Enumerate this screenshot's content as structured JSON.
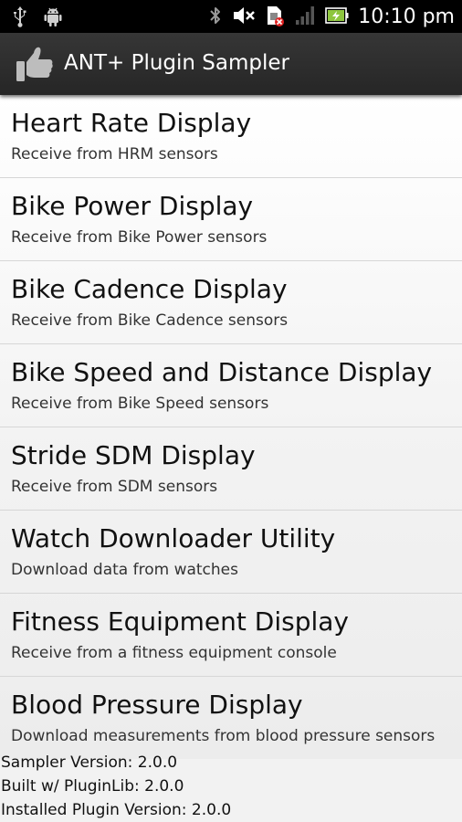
{
  "status_bar": {
    "time": "10:10 pm",
    "icons": [
      "usb-icon",
      "android-debug-icon",
      "bluetooth-icon",
      "mute-icon",
      "sim-missing-icon",
      "signal-icon",
      "battery-charging-icon"
    ]
  },
  "action_bar": {
    "title": "ANT+ Plugin Sampler",
    "icon": "thumbs-up-icon"
  },
  "list": {
    "items": [
      {
        "title": "Heart Rate Display",
        "subtitle": "Receive from HRM sensors"
      },
      {
        "title": "Bike Power Display",
        "subtitle": "Receive from Bike Power sensors"
      },
      {
        "title": "Bike Cadence Display",
        "subtitle": "Receive from Bike Cadence sensors"
      },
      {
        "title": "Bike Speed and Distance Display",
        "subtitle": "Receive from Bike Speed sensors"
      },
      {
        "title": "Stride SDM Display",
        "subtitle": "Receive from SDM sensors"
      },
      {
        "title": "Watch Downloader Utility",
        "subtitle": "Download data from watches"
      },
      {
        "title": "Fitness Equipment Display",
        "subtitle": "Receive from a fitness equipment console"
      },
      {
        "title": "Blood Pressure Display",
        "subtitle": "Download measurements from blood pressure sensors"
      }
    ]
  },
  "footer": {
    "sampler_version": "Sampler Version: 2.0.0",
    "built_with": "Built w/ PluginLib: 2.0.0",
    "installed_plugin": "Installed Plugin Version: 2.0.0"
  },
  "colors": {
    "status_bar_bg": "#000000",
    "action_bar_bg": "#2e2e2e",
    "list_bg": "#f2f2f2",
    "battery_green": "#8ec63f",
    "sim_red": "#e02020"
  }
}
